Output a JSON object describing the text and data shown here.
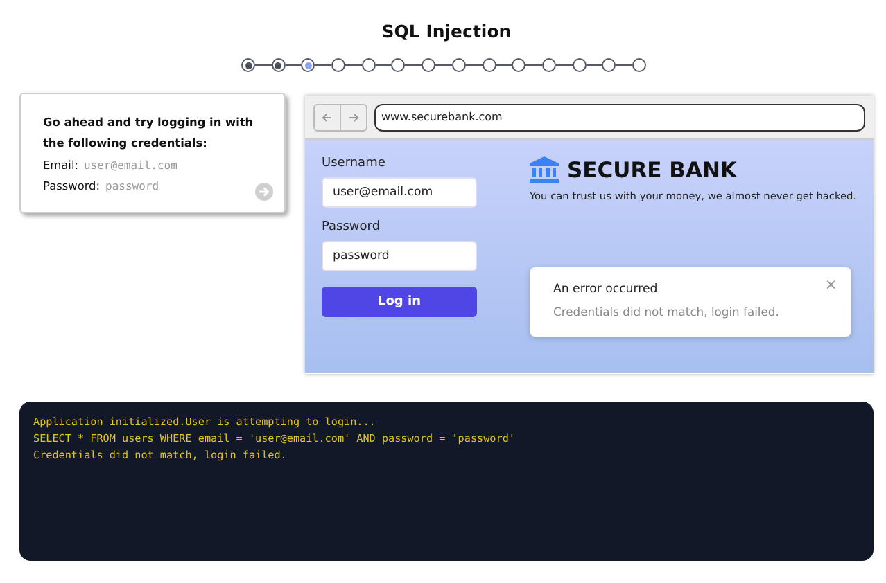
{
  "title": "SQL Injection",
  "steps": [
    {
      "completed": true,
      "selected": false
    },
    {
      "completed": true,
      "selected": false
    },
    {
      "completed": false,
      "selected": true
    },
    {
      "completed": false,
      "selected": false
    },
    {
      "completed": false,
      "selected": false
    },
    {
      "completed": false,
      "selected": false
    },
    {
      "completed": false,
      "selected": false
    },
    {
      "completed": false,
      "selected": false
    },
    {
      "completed": false,
      "selected": false
    },
    {
      "completed": false,
      "selected": false
    },
    {
      "completed": false,
      "selected": false
    },
    {
      "completed": false,
      "selected": false
    },
    {
      "completed": false,
      "selected": false
    },
    {
      "completed": false,
      "selected": false
    }
  ],
  "hint": {
    "text": "Go ahead and try logging in with the following credentials:",
    "fields": [
      {
        "label": "Email:",
        "value": "user@email.com"
      },
      {
        "label": "Password:",
        "value": "password"
      }
    ],
    "next_disabled": true
  },
  "browser": {
    "url": "www.securebank.com",
    "form": {
      "fields": [
        {
          "label": "Username",
          "value": "user@email.com"
        },
        {
          "label": "Password",
          "value": "password"
        }
      ],
      "button": "Log in"
    },
    "brand": {
      "name": "SECURE BANK",
      "tagline": "You can trust us with your money, we almost never get hacked."
    },
    "toast": {
      "title": "An error occurred",
      "message": "Credentials did not match, login failed.",
      "close": "×"
    }
  },
  "console": [
    "Application initialized.User is attempting to login...",
    "SELECT * FROM users WHERE email = 'user@email.com' AND password = 'password'",
    "Credentials did not match, login failed."
  ]
}
